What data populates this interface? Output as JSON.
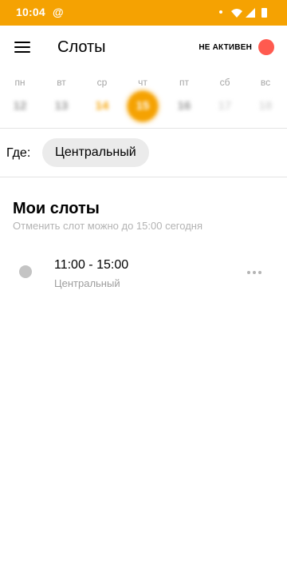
{
  "status_bar": {
    "time": "10:04",
    "notification_icon": "at-sign-icon",
    "system_icons": [
      "dot-icon",
      "wifi-icon",
      "signal-icon",
      "battery-icon"
    ]
  },
  "app_bar": {
    "title": "Слоты",
    "menu_icon": "hamburger-menu-icon",
    "status_label": "НЕ АКТИВЕН",
    "status_color": "#ff5a4f"
  },
  "week": {
    "days": [
      {
        "name": "пн",
        "number": "12"
      },
      {
        "name": "вт",
        "number": "13"
      },
      {
        "name": "ср",
        "number": "14"
      },
      {
        "name": "чт",
        "number": "15"
      },
      {
        "name": "пт",
        "number": "16"
      },
      {
        "name": "сб",
        "number": "17"
      },
      {
        "name": "вс",
        "number": "18"
      }
    ],
    "today_index": 2,
    "selected_index": 3
  },
  "where": {
    "label": "Где:",
    "selected_place": "Центральный"
  },
  "my_slots": {
    "title": "Мои слоты",
    "subtitle": "Отменить слот можно до 15:00 сегодня",
    "items": [
      {
        "time": "11:00 - 15:00",
        "place": "Центральный"
      }
    ]
  },
  "colors": {
    "accent": "#f5a202",
    "inactive": "#ff5a4f"
  }
}
